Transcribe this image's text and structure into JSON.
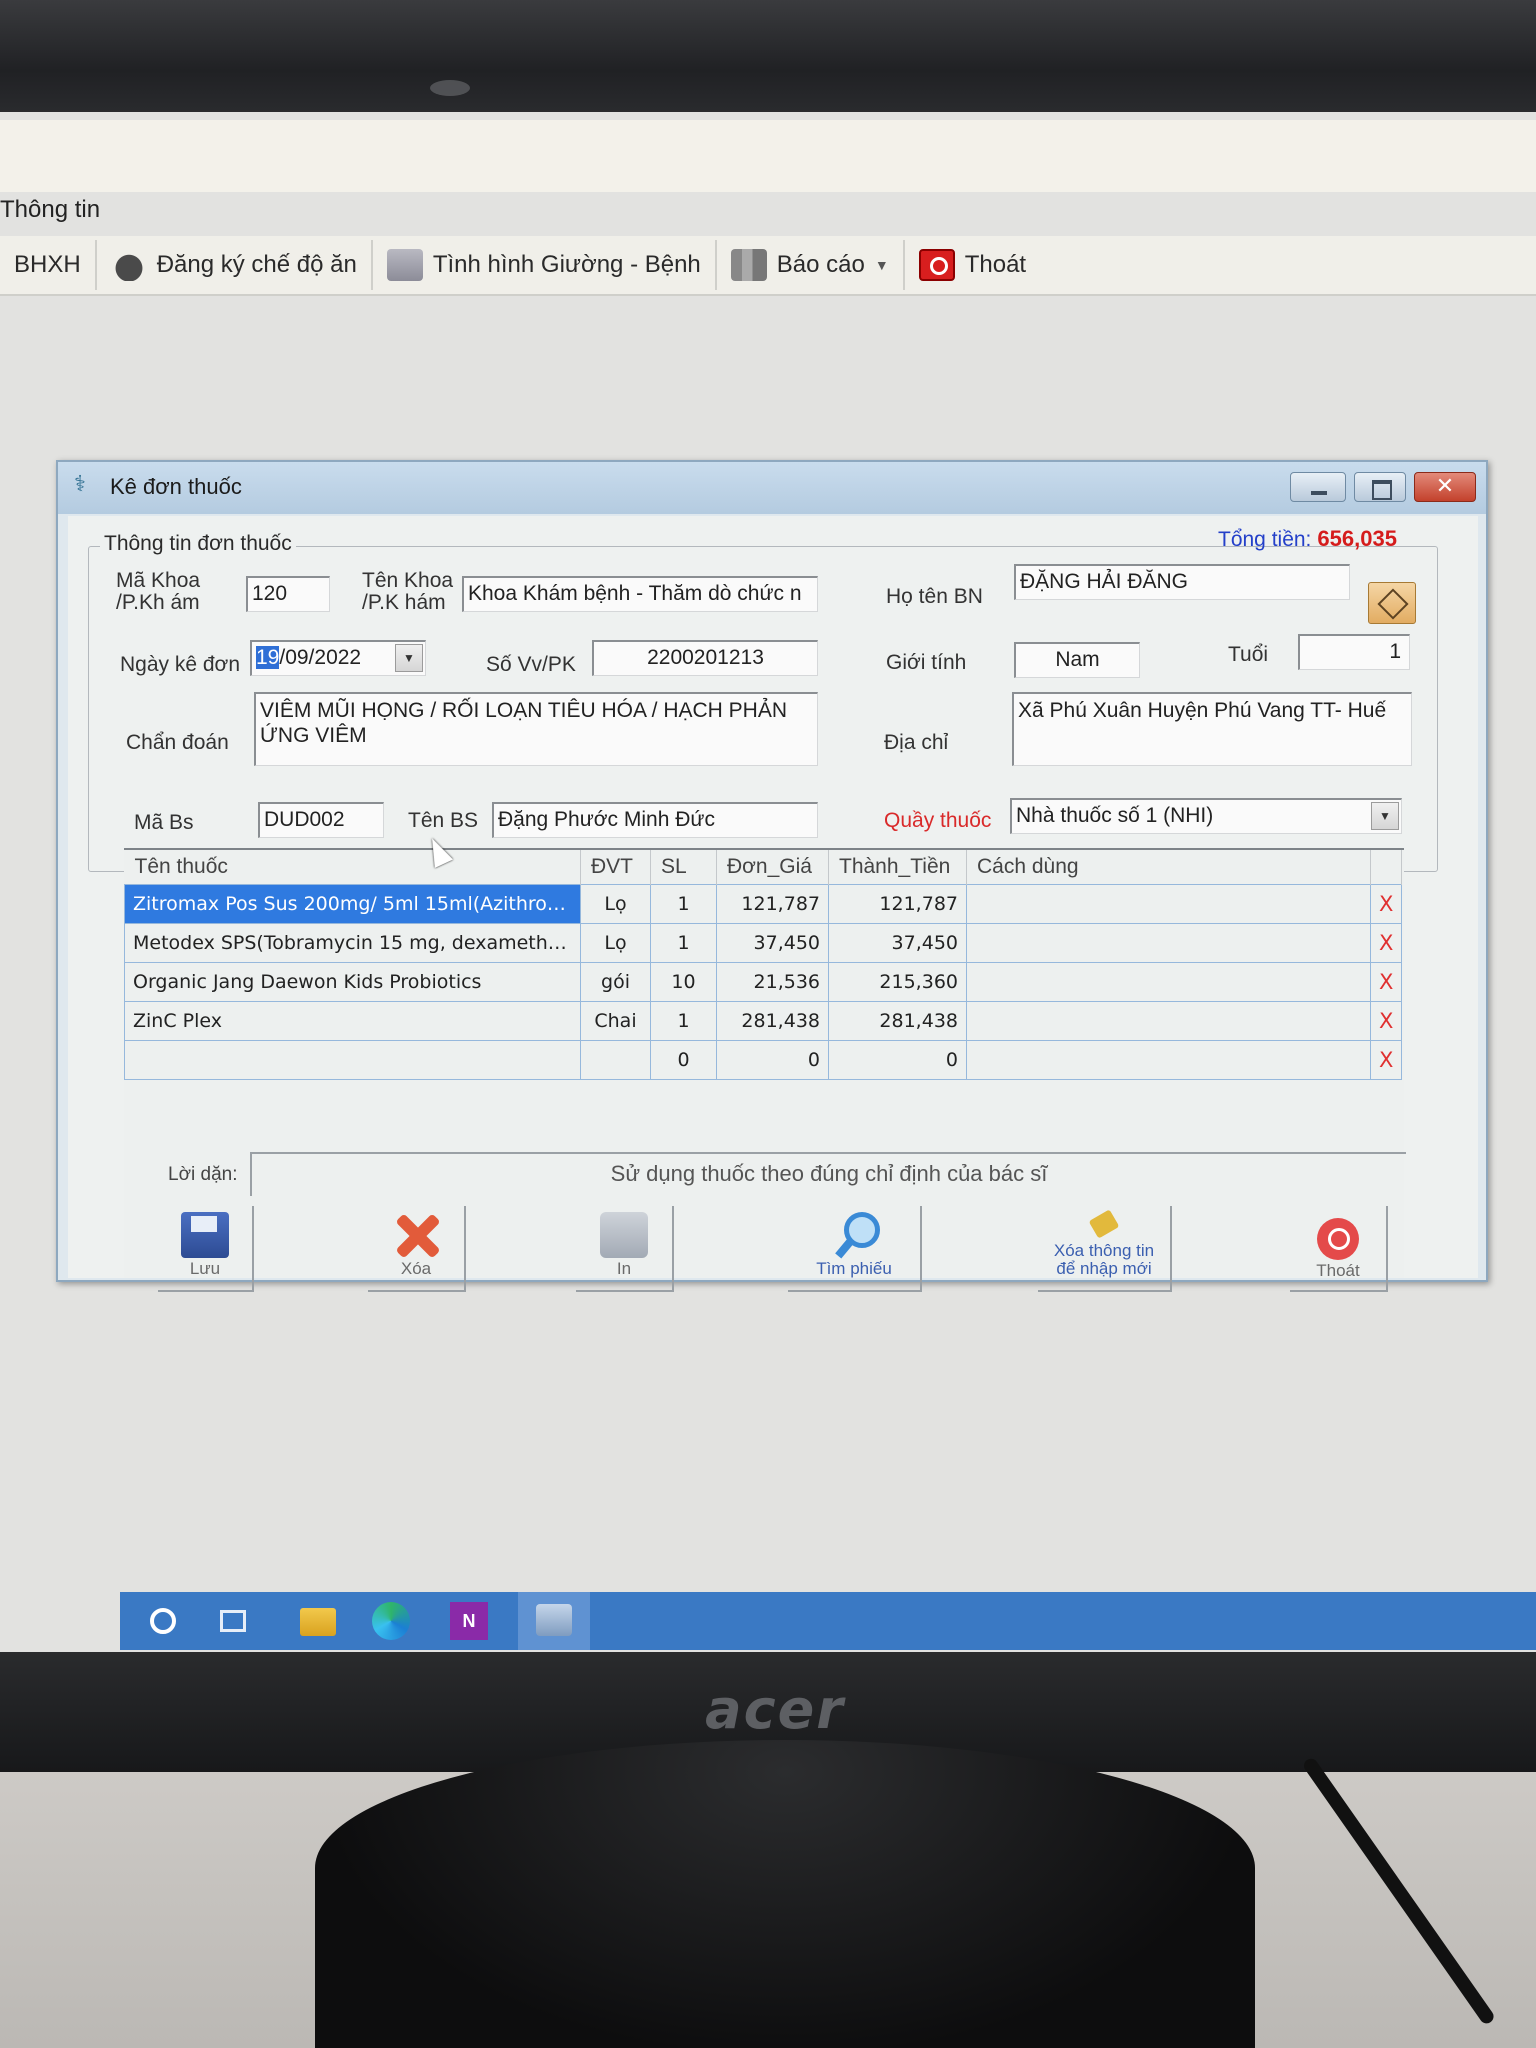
{
  "menu": {
    "info_label": "Thông tin"
  },
  "toolbar": {
    "items": [
      {
        "label": "BHXH",
        "icon": "card-icon"
      },
      {
        "label": "Đăng ký chế độ ăn",
        "icon": "food-icon"
      },
      {
        "label": "Tình hình Giường - Bệnh",
        "icon": "bed-icon"
      },
      {
        "label": "Báo cáo",
        "icon": "report-icon"
      },
      {
        "label": "Thoát",
        "icon": "exit-icon"
      }
    ]
  },
  "dialog": {
    "title": "Kê đơn thuốc",
    "section_title": "Thông tin đơn thuốc",
    "total_label": "Tổng tiền:",
    "total_value": "656,035",
    "fields": {
      "ma_khoa_label": "Mã Khoa /P.Kh ám",
      "ma_khoa_value": "120",
      "ten_khoa_label": "Tên Khoa /P.K hám",
      "ten_khoa_value": "Khoa Khám bệnh - Thăm dò chức n",
      "ho_ten_label": "Họ tên BN",
      "ho_ten_value": "ĐẶNG HẢI ĐĂNG",
      "ngay_ke_don_label": "Ngày kê đơn",
      "ngay_day": "19",
      "ngay_rest": "/09/2022",
      "so_vv_label": "Số Vv/PK",
      "so_vv_value": "2200201213",
      "gioi_tinh_label": "Giới tính",
      "gioi_tinh_value": "Nam",
      "tuoi_label": "Tuổi",
      "tuoi_value": "1",
      "chan_doan_label": "Chẩn đoán",
      "chan_doan_value": "VIÊM MŨI HỌNG / RỐI LOẠN TIÊU HÓA / HẠCH PHẢN ỨNG VIÊM",
      "dia_chi_label": "Địa chỉ",
      "dia_chi_value": "Xã Phú Xuân Huyện Phú Vang TT- Huế",
      "ma_bs_label": "Mã Bs",
      "ma_bs_value": "DUD002",
      "ten_bs_label": "Tên BS",
      "ten_bs_value": "Đặng Phước Minh Đức",
      "quay_thuoc_label": "Quầy thuốc",
      "quay_thuoc_value": "Nhà thuốc số 1 (NHI)"
    },
    "grid": {
      "headers": [
        "Tên thuốc",
        "ĐVT",
        "SL",
        "Đơn_Giá",
        "Thành_Tiền",
        "Cách dùng"
      ],
      "rows": [
        {
          "name": "Zitromax Pos Sus 200mg/ 5ml 15ml(Azithro…",
          "unit": "Lọ",
          "qty": "1",
          "price": "121,787",
          "amount": "121,787",
          "usage": "",
          "delete": "X"
        },
        {
          "name": "Metodex SPS(Tobramycin 15 mg, dexameth…",
          "unit": "Lọ",
          "qty": "1",
          "price": "37,450",
          "amount": "37,450",
          "usage": "",
          "delete": "X"
        },
        {
          "name": "Organic Jang Daewon Kids Probiotics",
          "unit": "gói",
          "qty": "10",
          "price": "21,536",
          "amount": "215,360",
          "usage": "",
          "delete": "X"
        },
        {
          "name": "ZinC Plex",
          "unit": "Chai",
          "qty": "1",
          "price": "281,438",
          "amount": "281,438",
          "usage": "",
          "delete": "X"
        },
        {
          "name": "",
          "unit": "",
          "qty": "0",
          "price": "0",
          "amount": "0",
          "usage": "",
          "delete": "X"
        }
      ]
    },
    "note_label": "Lời dặn:",
    "note_value": "Sử dụng thuốc theo đúng chỉ định của bác sĩ",
    "buttons": {
      "save": "Lưu",
      "delete": "Xóa",
      "print": "In",
      "find": "Tìm phiếu",
      "clear_line1": "Xóa thông tin",
      "clear_line2": "để nhập mới",
      "exit": "Thoát"
    }
  },
  "taskbar": {
    "onenote_letter": "N"
  },
  "monitor": {
    "brand": "acer"
  }
}
